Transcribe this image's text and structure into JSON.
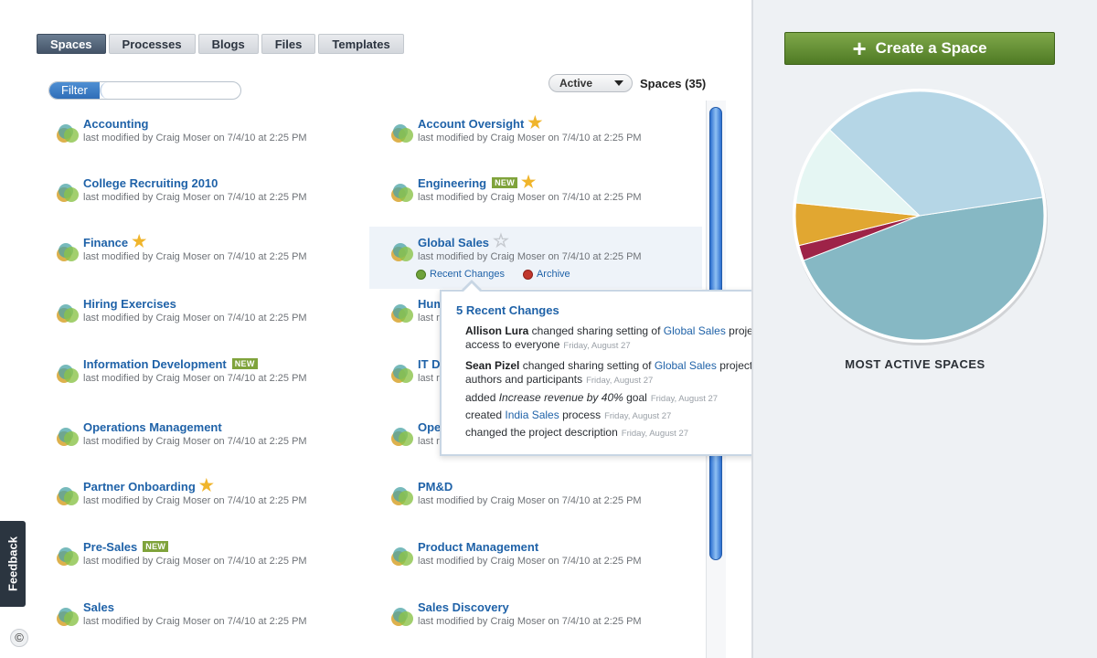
{
  "tabs": [
    "Spaces",
    "Processes",
    "Blogs",
    "Files",
    "Templates"
  ],
  "active_tab": "Spaces",
  "filter": {
    "label": "Filter",
    "value": ""
  },
  "status_select": {
    "value": "Active"
  },
  "spaces_count": "Spaces (35)",
  "meta_text": "last modified by Craig Moser on 7/4/10 at 2:25 PM",
  "badge_new": "NEW",
  "spaces_left": [
    {
      "name": "Accounting"
    },
    {
      "name": "College Recruiting 2010"
    },
    {
      "name": "Finance",
      "star": true
    },
    {
      "name": "Hiring Exercises"
    },
    {
      "name": "Information Development",
      "badge": true
    },
    {
      "name": "Operations Management"
    },
    {
      "name": "Partner Onboarding",
      "star": true
    },
    {
      "name": "Pre-Sales",
      "badge": true
    },
    {
      "name": "Sales"
    }
  ],
  "spaces_right": [
    {
      "name": "Account Oversight",
      "star": true
    },
    {
      "name": "Engineering",
      "badge": true,
      "star": true
    },
    {
      "name": "Global Sales",
      "star_empty": true
    },
    {
      "name": "Hum",
      "meta": "last r"
    },
    {
      "name": "IT D",
      "meta": "last r"
    },
    {
      "name": "Ope",
      "meta": "last r"
    },
    {
      "name": "PM&D"
    },
    {
      "name": "Product Management"
    },
    {
      "name": "Sales Discovery"
    }
  ],
  "hover_actions": {
    "recent": "Recent Changes",
    "archive": "Archive"
  },
  "popover": {
    "title": "5 Recent Changes",
    "changes": [
      {
        "user": "Allison Lura",
        "pre": " changed sharing setting of ",
        "link": "Global Sales",
        "post": " project to allow access to everyone",
        "date": "Friday, August 27"
      },
      {
        "user": "Sean Pizel",
        "pre": " changed sharing setting of ",
        "link": "Global Sales",
        "post": " project to select authors and participants",
        "date": "Friday, August 27"
      },
      {
        "pre": "added ",
        "emph": "Increase revenue by 40%",
        "post": " goal",
        "date": "Friday, August 27"
      },
      {
        "pre": "created ",
        "link": "India Sales",
        "post": " process",
        "date": "Friday, August 27"
      },
      {
        "pre": "changed the project description",
        "date": "Friday, August 27"
      }
    ]
  },
  "create_button": "Create a Space",
  "pie": {
    "caption": "MOST ACTIVE SPACES",
    "slices": [
      {
        "value": 46.5,
        "color": "#86b8c4"
      },
      {
        "value": 2.0,
        "color": "#9e2348"
      },
      {
        "value": 5.5,
        "color": "#e1a731"
      },
      {
        "value": 10.5,
        "color": "#e5f6f3"
      },
      {
        "value": 35.5,
        "color": "#b5d6e6"
      }
    ]
  },
  "feedback_label": "Feedback",
  "copyright_symbol": "©"
}
